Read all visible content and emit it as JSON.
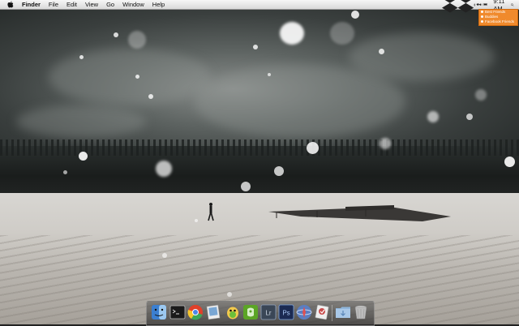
{
  "menubar": {
    "apple_icon": "apple-icon",
    "app_name": "Finder",
    "menus": [
      "File",
      "Edit",
      "View",
      "Go",
      "Window",
      "Help"
    ],
    "status_icons": [
      "dropbox-icon",
      "bluetooth-icon",
      "wifi-icon",
      "volume-icon",
      "battery-icon"
    ],
    "time": "9:11 AM",
    "search_icon": "spotlight-icon"
  },
  "notification": {
    "color": "#f08a2c",
    "items": [
      "Best Friends",
      "Buddies",
      "Facebook Friends"
    ]
  },
  "dock": {
    "items": [
      {
        "name": "finder-icon",
        "color": "#3b7fd1"
      },
      {
        "name": "terminal-icon",
        "color": "#1a1a1a"
      },
      {
        "name": "chrome-icon",
        "color": "#e0402a"
      },
      {
        "name": "preview-icon",
        "color": "#7aa7d4"
      },
      {
        "name": "adium-icon",
        "color": "#f2c94c"
      },
      {
        "name": "evernote-icon",
        "color": "#5ba525"
      },
      {
        "name": "lightroom-icon",
        "color": "#3a4656",
        "label": "Lr"
      },
      {
        "name": "photoshop-icon",
        "color": "#1b2a52",
        "label": "Ps"
      },
      {
        "name": "safari-icon",
        "color": "#5a7ec2"
      },
      {
        "name": "textmate-icon",
        "color": "#c94b4b"
      },
      {
        "name": "downloads-folder-icon",
        "color": "#8fb5da"
      },
      {
        "name": "trash-icon",
        "color": "#9a9a9a"
      }
    ]
  }
}
